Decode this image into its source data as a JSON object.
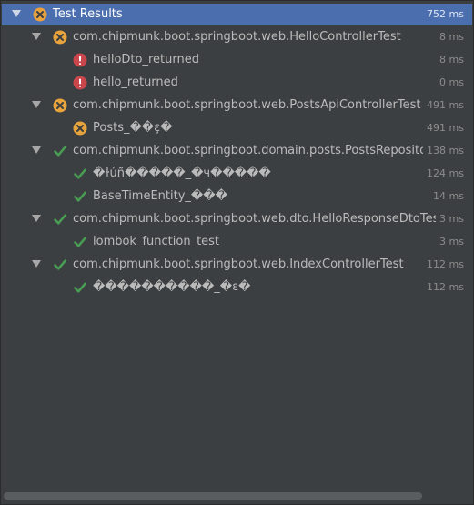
{
  "panel_title": "Test Results",
  "rows": [
    {
      "label": "Test Results",
      "time": "752 ms",
      "status": "failed",
      "icon": "failed-test-icon"
    },
    {
      "label": "com.chipmunk.boot.springboot.web.HelloControllerTest",
      "time": "8 ms",
      "status": "failed",
      "icon": "failed-test-icon"
    },
    {
      "label": "helloDto_returned",
      "time": "8 ms",
      "status": "error",
      "icon": "error-test-icon"
    },
    {
      "label": "hello_returned",
      "time": "0 ms",
      "status": "error",
      "icon": "error-test-icon"
    },
    {
      "label": "com.chipmunk.boot.springboot.web.PostsApiControllerTest",
      "time": "491 ms",
      "status": "failed",
      "icon": "failed-test-icon"
    },
    {
      "label": "Posts_��ɛ̧�",
      "time": "491 ms",
      "status": "failed",
      "icon": "failed-test-icon"
    },
    {
      "label": "com.chipmunk.boot.springboot.domain.posts.PostsRepositoryTest",
      "time": "138 ms",
      "status": "passed",
      "icon": "check-icon"
    },
    {
      "label": "�ɫúñ�����_�ч�����",
      "time": "124 ms",
      "status": "passed",
      "icon": "check-icon"
    },
    {
      "label": "BaseTimeEntity_���",
      "time": "14 ms",
      "status": "passed",
      "icon": "check-icon"
    },
    {
      "label": "com.chipmunk.boot.springboot.web.dto.HelloResponseDtoTest",
      "time": "3 ms",
      "status": "passed",
      "icon": "check-icon"
    },
    {
      "label": "lombok_function_test",
      "time": "3 ms",
      "status": "passed",
      "icon": "check-icon"
    },
    {
      "label": "com.chipmunk.boot.springboot.web.IndexControllerTest",
      "time": "112 ms",
      "status": "passed",
      "icon": "check-icon"
    },
    {
      "label": "����������_�ɛ�",
      "time": "112 ms",
      "status": "passed",
      "icon": "check-icon"
    }
  ],
  "colors": {
    "background": "#3c3f41",
    "selection": "#4b6eaf",
    "failed": "#e8a33d",
    "error": "#c9464d",
    "passed": "#499c54"
  }
}
